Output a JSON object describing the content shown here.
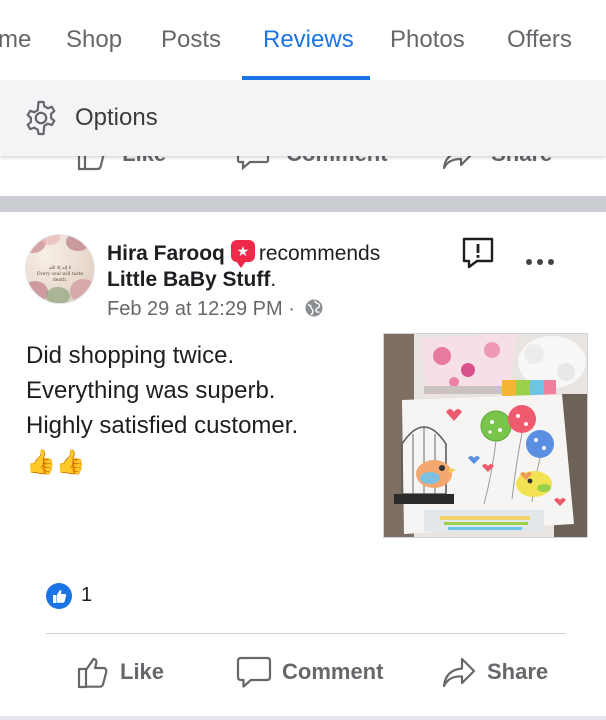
{
  "tabs": [
    {
      "label": "me",
      "active": false
    },
    {
      "label": "Shop",
      "active": false
    },
    {
      "label": "Posts",
      "active": false
    },
    {
      "label": "Reviews",
      "active": true
    },
    {
      "label": "Photos",
      "active": false
    },
    {
      "label": "Offers",
      "active": false
    }
  ],
  "options": {
    "label": "Options",
    "icon": "gear-icon"
  },
  "previous_post_actions": [
    "Like",
    "Comment",
    "Share"
  ],
  "post": {
    "author": "Hira Farooq",
    "verb": "recommends",
    "page": "Little BaBy Stuff",
    "page_suffix": ".",
    "timestamp": "Feb 29 at 12:29 PM",
    "separator": "·",
    "privacy_icon": "globe-icon",
    "avatar_text": [
      "لا إله إلا الله",
      "Every soul will taste death."
    ],
    "review_lines": [
      "Did shopping twice.",
      "Everything was superb.",
      "Highly satisfied customer."
    ],
    "emoji": "👍👍",
    "reactions": {
      "icon": "like-reaction-icon",
      "count": "1"
    },
    "actions": [
      {
        "label": "Like",
        "icon": "like-icon"
      },
      {
        "label": "Comment",
        "icon": "comment-icon"
      },
      {
        "label": "Share",
        "icon": "share-icon"
      }
    ]
  },
  "colors": {
    "accent": "#1b74e4",
    "recommend_badge": "#f02849",
    "secondary_text": "#65676b"
  }
}
